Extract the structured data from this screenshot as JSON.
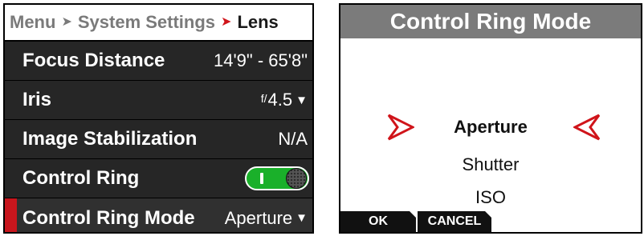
{
  "lens_menu": {
    "breadcrumb": {
      "item1": "Menu",
      "item2": "System Settings",
      "current": "Lens"
    },
    "rows": {
      "focus_distance": {
        "label": "Focus Distance",
        "value": "14'9\" - 65'8\""
      },
      "iris": {
        "label": "Iris",
        "f_prefix": "f/",
        "value": "4.5"
      },
      "image_stabilization": {
        "label": "Image Stabilization",
        "value": "N/A"
      },
      "control_ring": {
        "label": "Control Ring",
        "state": "on"
      },
      "control_ring_mode": {
        "label": "Control Ring Mode",
        "value": "Aperture"
      }
    }
  },
  "mode_dialog": {
    "title": "Control Ring Mode",
    "options": [
      "Aperture",
      "Shutter",
      "ISO"
    ],
    "selected_option": "Aperture",
    "softkeys": {
      "ok": "OK",
      "cancel": "CANCEL"
    }
  },
  "colors": {
    "accent_red": "#d0141a",
    "selection_bar": "#c8161d",
    "toggle_on": "#1ab02a",
    "dialog_header": "#7b7b7b"
  },
  "icons": {
    "breadcrumb_separator": "chevron-right-icon",
    "dropdown": "caret-down-icon",
    "selection_pointer": "red-arrow-icon"
  }
}
